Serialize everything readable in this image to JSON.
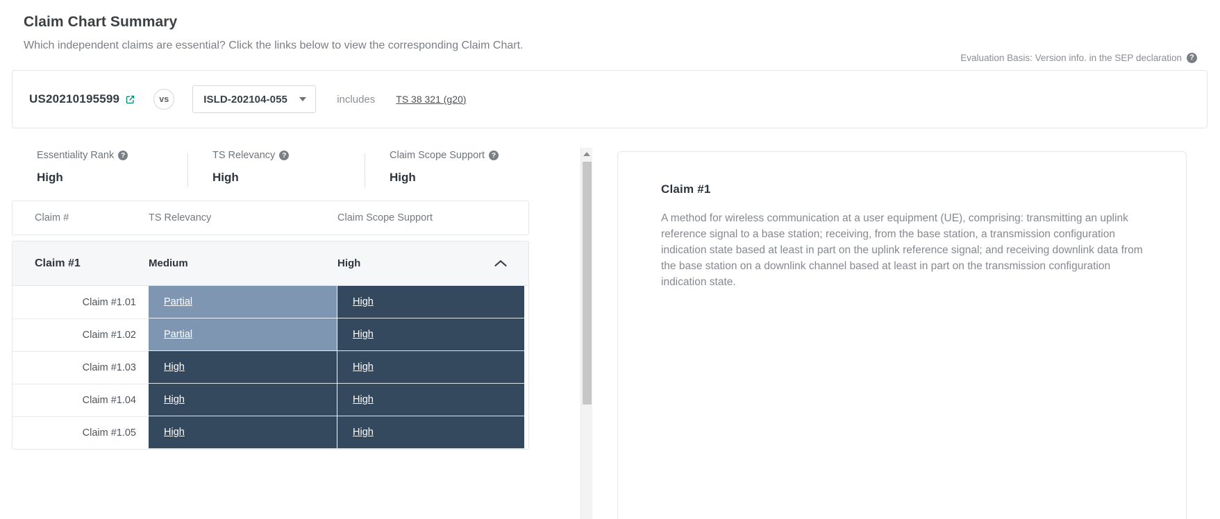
{
  "header": {
    "title": "Claim Chart Summary",
    "subtitle": "Which independent claims are essential? Click the links below to view the corresponding Claim Chart.",
    "evaluation_basis": "Evaluation Basis: Version info. in the SEP declaration",
    "help_glyph": "?"
  },
  "comparison": {
    "patent_number": "US20210195599",
    "external_link_icon": "external-link-icon",
    "vs_label": "vs",
    "dropdown_value": "ISLD-202104-055",
    "includes_label": "includes",
    "spec_link": "TS 38 321 (g20)"
  },
  "stats": [
    {
      "label": "Essentiality Rank",
      "value": "High"
    },
    {
      "label": "TS Relevancy",
      "value": "High"
    },
    {
      "label": "Claim Scope Support",
      "value": "High"
    }
  ],
  "table": {
    "columns": {
      "claim": "Claim #",
      "ts_relevancy": "TS Relevancy",
      "claim_scope_support": "Claim Scope Support"
    },
    "group": {
      "claim": "Claim #1",
      "ts_relevancy": "Medium",
      "claim_scope_support": "High",
      "collapse_icon": "chevron-up-icon"
    },
    "rows": [
      {
        "claim": "Claim #1.01",
        "ts_relevancy": "Partial",
        "ts_level": "partial",
        "claim_scope_support": "High",
        "scope_level": "high"
      },
      {
        "claim": "Claim #1.02",
        "ts_relevancy": "Partial",
        "ts_level": "partial",
        "claim_scope_support": "High",
        "scope_level": "high"
      },
      {
        "claim": "Claim #1.03",
        "ts_relevancy": "High",
        "ts_level": "high",
        "claim_scope_support": "High",
        "scope_level": "high"
      },
      {
        "claim": "Claim #1.04",
        "ts_relevancy": "High",
        "ts_level": "high",
        "claim_scope_support": "High",
        "scope_level": "high"
      },
      {
        "claim": "Claim #1.05",
        "ts_relevancy": "High",
        "ts_level": "high",
        "claim_scope_support": "High",
        "scope_level": "high"
      }
    ]
  },
  "detail_panel": {
    "title": "Claim #1",
    "text": "A method for wireless communication at a user equipment (UE), comprising: transmitting an uplink reference signal to a base station; receiving, from the base station, a transmission configuration indication state based at least in part on the uplink reference signal; and receiving downlink data from the base station on a downlink channel based at least in part on the transmission configuration indication state."
  },
  "colors": {
    "level_high": "#34495e",
    "level_partial": "#7e96b2",
    "accent_link": "#00897b"
  }
}
